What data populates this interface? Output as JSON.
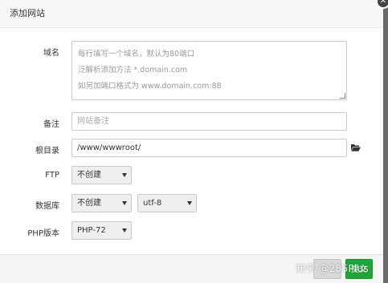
{
  "dialog": {
    "title": "添加网站",
    "close_glyph": "✕"
  },
  "form": {
    "domain": {
      "label": "域名",
      "lines": [
        "每行填写一个域名，默认为80端口",
        "泛解析添加方法 *.domain.com",
        "如另加端口格式为 www.domain.com:88"
      ]
    },
    "remark": {
      "label": "备注",
      "placeholder": "网站备注"
    },
    "root": {
      "label": "根目录",
      "value": "/www/wwwroot/",
      "icon": "folder-open-icon"
    },
    "ftp": {
      "label": "FTP",
      "selected": "不创建"
    },
    "database": {
      "label": "数据库",
      "selected": "不创建",
      "charset": "utf-8"
    },
    "php": {
      "label": "PHP版本",
      "selected": "PHP-72"
    }
  },
  "footer": {
    "cancel_label": "",
    "submit_label": "提交"
  },
  "watermark": "知乎 @285Plus",
  "colors": {
    "accent": "#20a53a",
    "overlay": "#6a6a6a"
  }
}
